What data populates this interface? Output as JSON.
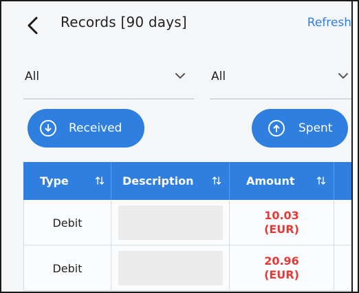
{
  "header": {
    "title": "Records [90 days]",
    "refresh_label": "Refresh"
  },
  "filters": [
    {
      "selected": "All"
    },
    {
      "selected": "All"
    }
  ],
  "actions": {
    "received_label": "Received",
    "spent_label": "Spent"
  },
  "table": {
    "columns": [
      "Type",
      "Description",
      "Amount"
    ],
    "rows": [
      {
        "type": "Debit",
        "description": "",
        "amount": "10.03",
        "currency": "(EUR)"
      },
      {
        "type": "Debit",
        "description": "",
        "amount": "20.96",
        "currency": "(EUR)"
      }
    ]
  },
  "colors": {
    "accent": "#2e7fe0",
    "amount_negative": "#e53935",
    "background": "#f4f6f8"
  },
  "icons": {
    "back": "chevron-left-icon",
    "dropdown": "chevron-down-icon",
    "received": "arrow-down-circle-icon",
    "spent": "arrow-up-circle-icon",
    "sort": "sort-arrows-icon"
  }
}
